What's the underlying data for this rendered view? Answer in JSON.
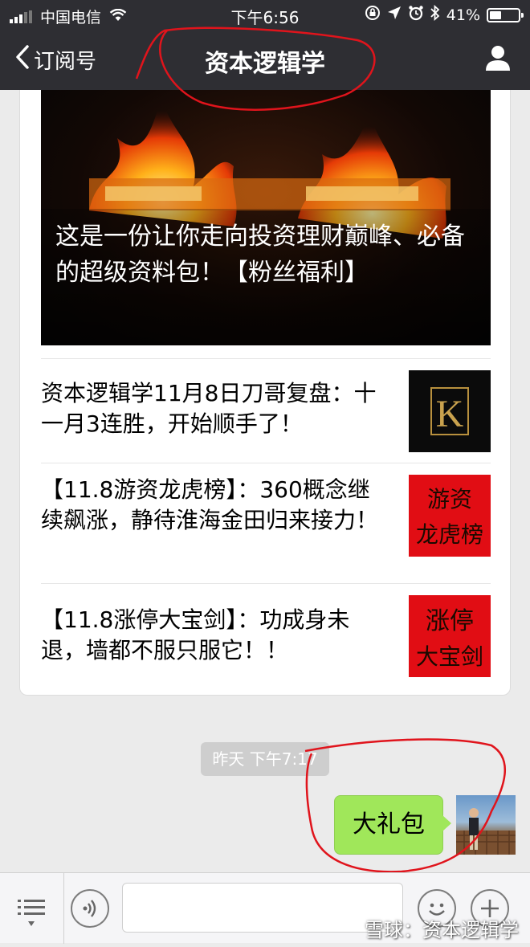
{
  "status_bar": {
    "carrier": "中国电信",
    "time": "下午6:56",
    "battery_percent": "41%",
    "battery_level": 0.41
  },
  "nav": {
    "back_label": "订阅号",
    "title": "资本逻辑学",
    "profile_icon": "person-icon"
  },
  "article": {
    "cover_title": "这是一份让你走向投资理财巅峰、必备的超级资料包！【粉丝福利】",
    "items": [
      {
        "title": "资本逻辑学11月8日刀哥复盘：十一月3连胜，开始顺手了！",
        "thumb_text": "K"
      },
      {
        "title": "【11.8游资龙虎榜】：360概念继续飙涨，静待淮海金田归来接力！",
        "thumb_text": "游资龙虎榜"
      },
      {
        "title": "【11.8涨停大宝剑】：功成身未退，墙都不服只服它！！",
        "thumb_text": "涨停大宝剑"
      }
    ]
  },
  "chat": {
    "timestamp": "昨天 下午7:17",
    "message": "大礼包"
  },
  "toolbar": {
    "menu_icon": "list-icon",
    "voice_icon": "voice-icon",
    "emoji_icon": "emoji-icon",
    "plus_icon": "plus-icon"
  },
  "watermark": "雪球：资本逻辑学",
  "colors": {
    "bar_bg": "#2e2e33",
    "bubble": "#a0e75a",
    "annotation": "#e0141c"
  }
}
